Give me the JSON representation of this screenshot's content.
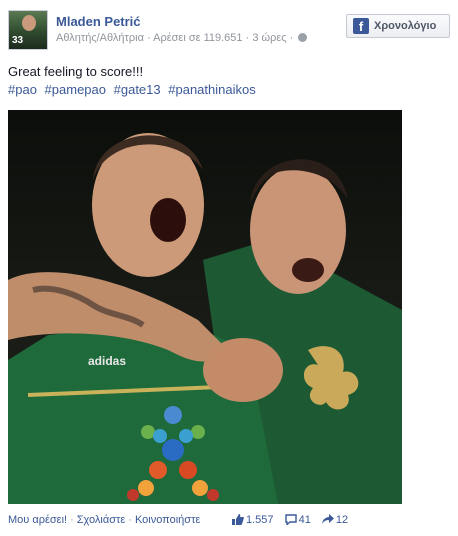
{
  "post": {
    "author": "Mladen Petrić",
    "category": "Αθλητής/Αθλήτρια",
    "likes_page": "Αρέσει σε 119.651",
    "time": "3 ώρες",
    "separator": "·",
    "avatar_number": "33",
    "timeline_button": "Χρονολόγιο",
    "message": "Great feeling to score!!!",
    "hashtags": [
      "#pao",
      "#pamepao",
      "#gate13",
      "#panathinaikos"
    ]
  },
  "actions": {
    "like": "Μου αρέσει!",
    "comment": "Σχολιάστε",
    "share": "Κοινοποιήστε",
    "sep": "·"
  },
  "counts": {
    "likes": "1.557",
    "comments": "41",
    "shares": "12"
  },
  "photo": {
    "jersey_brand": "adidas",
    "jersey_number_alt": "Tattoo"
  },
  "colors": {
    "link": "#3b5998",
    "meta": "#90949c",
    "jersey_green": "#1f6a3a"
  },
  "icons": {
    "logo": "facebook-icon",
    "privacy": "globe-icon",
    "likes": "thumbs-up-icon",
    "comments": "comment-icon",
    "shares": "share-arrow-icon"
  }
}
